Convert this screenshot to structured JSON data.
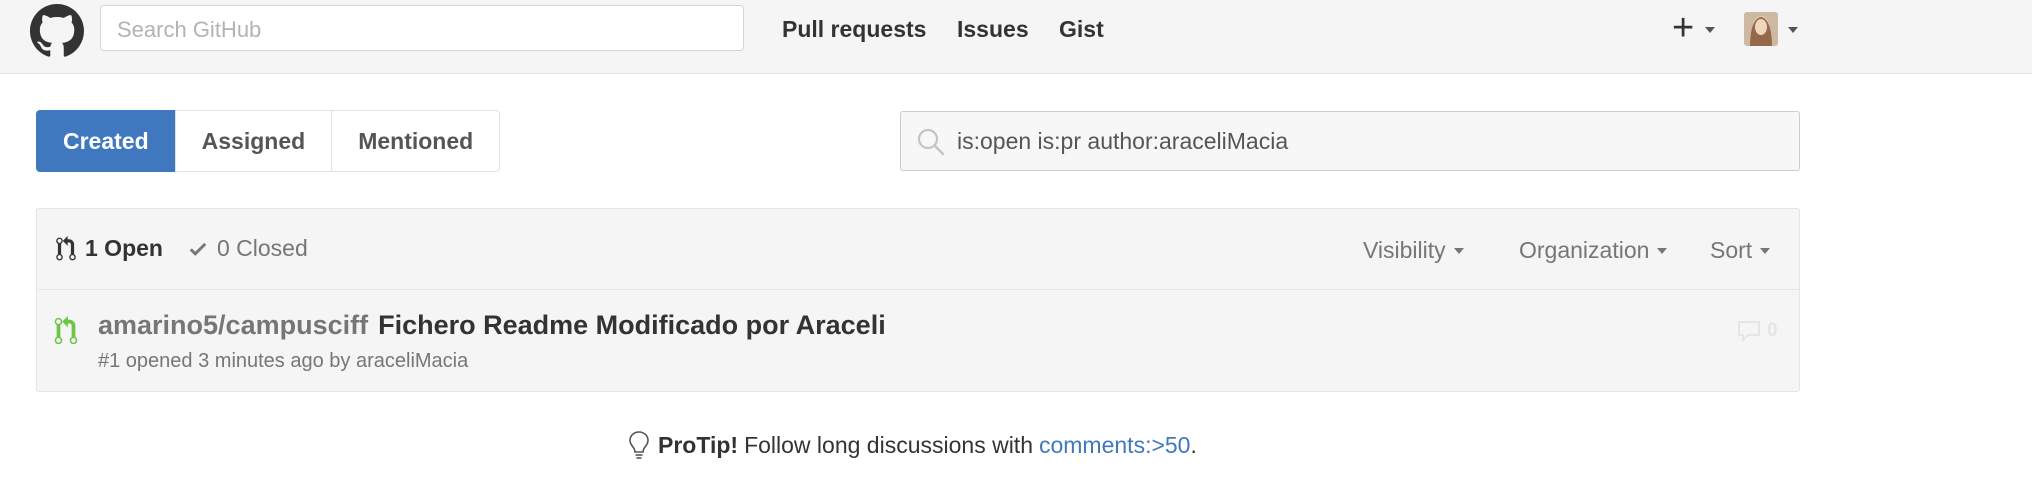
{
  "header": {
    "search_placeholder": "Search GitHub",
    "nav": [
      "Pull requests",
      "Issues",
      "Gist"
    ],
    "plus": "+"
  },
  "subnav": {
    "items": [
      "Created",
      "Assigned",
      "Mentioned"
    ],
    "selected": "Created"
  },
  "filter": {
    "query": "is:open is:pr author:araceliMacia"
  },
  "states": {
    "open_label": "1 Open",
    "closed_label": "0 Closed"
  },
  "filters": {
    "visibility": "Visibility",
    "organization": "Organization",
    "sort": "Sort"
  },
  "pull_requests": [
    {
      "repo": "amarino5/campusciff",
      "title": "Fichero Readme Modificado por Araceli",
      "meta": "#1 opened 3 minutes ago by araceliMacia",
      "comments": "0"
    }
  ],
  "protip": {
    "label": "ProTip!",
    "text": "Follow long discussions with",
    "link": "comments:>50",
    "end": "."
  },
  "colors": {
    "accent": "#4078c0",
    "open_green": "#6cc644",
    "header_bg": "#f5f5f5"
  }
}
